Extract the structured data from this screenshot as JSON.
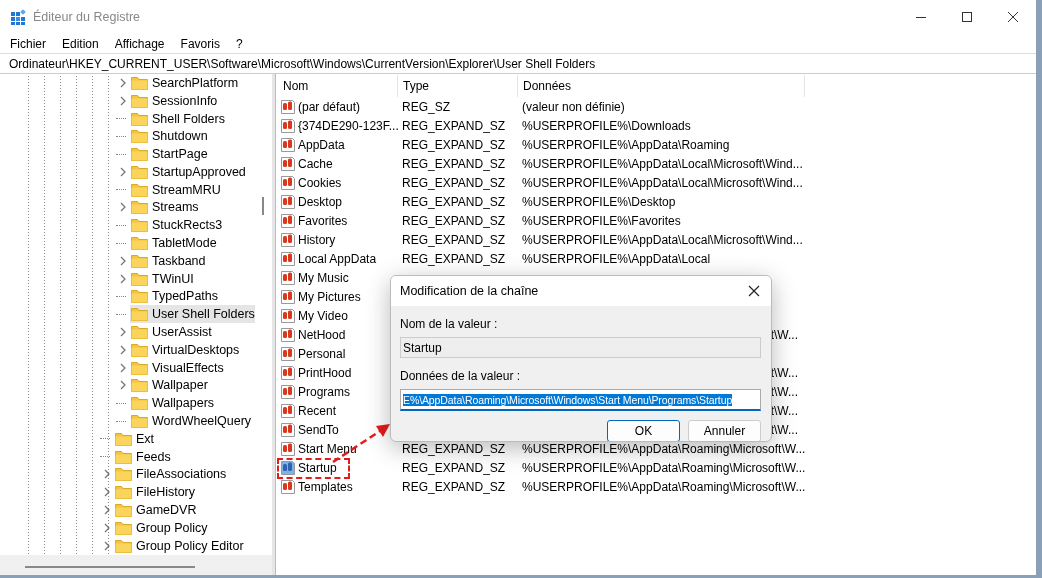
{
  "window": {
    "title": "Éditeur du Registre"
  },
  "menu": [
    "Fichier",
    "Edition",
    "Affichage",
    "Favoris",
    "?"
  ],
  "address": "Ordinateur\\HKEY_CURRENT_USER\\Software\\Microsoft\\Windows\\CurrentVersion\\Explorer\\User Shell Folders",
  "tree": {
    "nested_items": [
      {
        "label": "SearchPlatform",
        "expandable": true,
        "selected": false
      },
      {
        "label": "SessionInfo",
        "expandable": true,
        "selected": false
      },
      {
        "label": "Shell Folders",
        "expandable": false,
        "selected": false
      },
      {
        "label": "Shutdown",
        "expandable": false,
        "selected": false
      },
      {
        "label": "StartPage",
        "expandable": false,
        "selected": false
      },
      {
        "label": "StartupApproved",
        "expandable": true,
        "selected": false
      },
      {
        "label": "StreamMRU",
        "expandable": false,
        "selected": false
      },
      {
        "label": "Streams",
        "expandable": true,
        "selected": false
      },
      {
        "label": "StuckRects3",
        "expandable": false,
        "selected": false
      },
      {
        "label": "TabletMode",
        "expandable": false,
        "selected": false
      },
      {
        "label": "Taskband",
        "expandable": true,
        "selected": false
      },
      {
        "label": "TWinUI",
        "expandable": true,
        "selected": false
      },
      {
        "label": "TypedPaths",
        "expandable": false,
        "selected": false
      },
      {
        "label": "User Shell Folders",
        "expandable": false,
        "selected": true
      },
      {
        "label": "UserAssist",
        "expandable": true,
        "selected": false
      },
      {
        "label": "VirtualDesktops",
        "expandable": true,
        "selected": false
      },
      {
        "label": "VisualEffects",
        "expandable": true,
        "selected": false
      },
      {
        "label": "Wallpaper",
        "expandable": true,
        "selected": false
      },
      {
        "label": "Wallpapers",
        "expandable": false,
        "selected": false
      },
      {
        "label": "WordWheelQuery",
        "expandable": false,
        "selected": false
      }
    ],
    "items": [
      {
        "label": "Ext",
        "expandable": false,
        "selected": false
      },
      {
        "label": "Feeds",
        "expandable": false,
        "selected": false
      },
      {
        "label": "FileAssociations",
        "expandable": true,
        "selected": false
      },
      {
        "label": "FileHistory",
        "expandable": true,
        "selected": false
      },
      {
        "label": "GameDVR",
        "expandable": true,
        "selected": false
      },
      {
        "label": "Group Policy",
        "expandable": true,
        "selected": false
      },
      {
        "label": "Group Policy Editor",
        "expandable": true,
        "selected": false
      }
    ]
  },
  "table": {
    "columns": [
      "Nom",
      "Type",
      "Données"
    ],
    "rows": [
      {
        "name": "(par défaut)",
        "type": "REG_SZ",
        "data": "(valeur non définie)",
        "selected": false,
        "highlighted": false
      },
      {
        "name": "{374DE290-123F...",
        "type": "REG_EXPAND_SZ",
        "data": "%USERPROFILE%\\Downloads",
        "selected": false,
        "highlighted": false
      },
      {
        "name": "AppData",
        "type": "REG_EXPAND_SZ",
        "data": "%USERPROFILE%\\AppData\\Roaming",
        "selected": false,
        "highlighted": false
      },
      {
        "name": "Cache",
        "type": "REG_EXPAND_SZ",
        "data": "%USERPROFILE%\\AppData\\Local\\Microsoft\\Wind...",
        "selected": false,
        "highlighted": false
      },
      {
        "name": "Cookies",
        "type": "REG_EXPAND_SZ",
        "data": "%USERPROFILE%\\AppData\\Local\\Microsoft\\Wind...",
        "selected": false,
        "highlighted": false
      },
      {
        "name": "Desktop",
        "type": "REG_EXPAND_SZ",
        "data": "%USERPROFILE%\\Desktop",
        "selected": false,
        "highlighted": false
      },
      {
        "name": "Favorites",
        "type": "REG_EXPAND_SZ",
        "data": "%USERPROFILE%\\Favorites",
        "selected": false,
        "highlighted": false
      },
      {
        "name": "History",
        "type": "REG_EXPAND_SZ",
        "data": "%USERPROFILE%\\AppData\\Local\\Microsoft\\Wind...",
        "selected": false,
        "highlighted": false
      },
      {
        "name": "Local AppData",
        "type": "REG_EXPAND_SZ",
        "data": "%USERPROFILE%\\AppData\\Local",
        "selected": false,
        "highlighted": false
      },
      {
        "name": "My Music",
        "selected": false,
        "highlighted": false
      },
      {
        "name": "My Pictures",
        "selected": false,
        "highlighted": false
      },
      {
        "name": "My Video",
        "selected": false,
        "highlighted": false
      },
      {
        "name": "NetHood",
        "data_tail": "t\\W...",
        "selected": false,
        "highlighted": false
      },
      {
        "name": "Personal",
        "selected": false,
        "highlighted": false
      },
      {
        "name": "PrintHood",
        "data_tail": "t\\W...",
        "selected": false,
        "highlighted": false
      },
      {
        "name": "Programs",
        "data_tail": "t\\W...",
        "selected": false,
        "highlighted": false
      },
      {
        "name": "Recent",
        "data_tail": "t\\W...",
        "selected": false,
        "highlighted": false
      },
      {
        "name": "SendTo",
        "data_tail": "t\\W...",
        "selected": false,
        "highlighted": false
      },
      {
        "name": "Start Menu",
        "type": "REG_EXPAND_SZ",
        "data": "%USERPROFILE%\\AppData\\Roaming\\Microsoft\\W...",
        "selected": false,
        "highlighted": false
      },
      {
        "name": "Startup",
        "type": "REG_EXPAND_SZ",
        "data": "%USERPROFILE%\\AppData\\Roaming\\Microsoft\\W...",
        "selected": true,
        "highlighted": true
      },
      {
        "name": "Templates",
        "type": "REG_EXPAND_SZ",
        "data": "%USERPROFILE%\\AppData\\Roaming\\Microsoft\\W...",
        "selected": false,
        "highlighted": false
      }
    ]
  },
  "dialog": {
    "title": "Modification de la chaîne",
    "name_label": "Nom de la valeur :",
    "name_value": "Startup",
    "data_label": "Données de la valeur :",
    "data_value": "E%\\AppData\\Roaming\\Microsoft\\Windows\\Start Menu\\Programs\\Startup",
    "buttons": [
      "OK",
      "Annuler"
    ]
  }
}
